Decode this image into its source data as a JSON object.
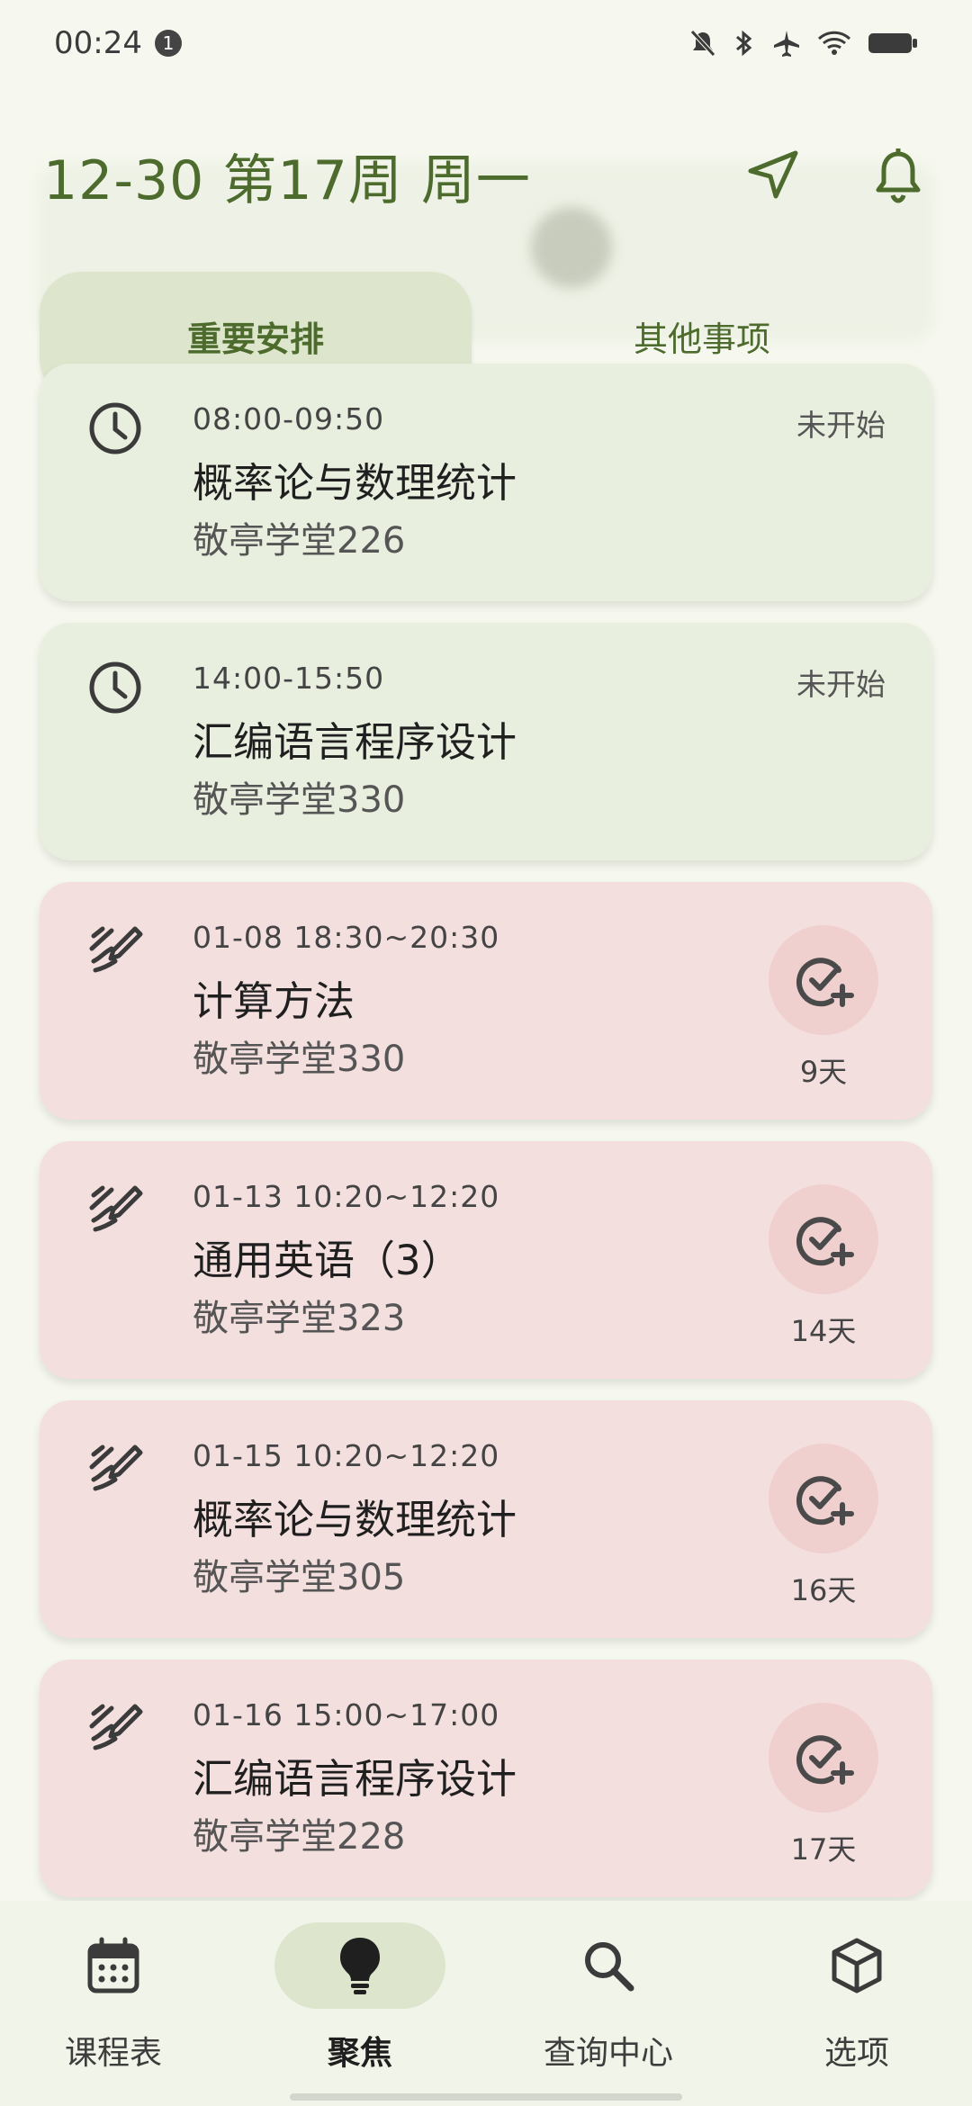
{
  "status_bar": {
    "time": "00:24",
    "notification_count": "1"
  },
  "header": {
    "title": "12-30 第17周 周一"
  },
  "tabs": [
    {
      "label": "重要安排",
      "active": true
    },
    {
      "label": "其他事项",
      "active": false
    }
  ],
  "cards": [
    {
      "type": "course",
      "icon": "clock-icon",
      "time": "08:00-09:50",
      "title": "概率论与数理统计",
      "place": "敬亭学堂226",
      "state": "未开始"
    },
    {
      "type": "course",
      "icon": "clock-icon",
      "time": "14:00-15:50",
      "title": "汇编语言程序设计",
      "place": "敬亭学堂330",
      "state": "未开始"
    },
    {
      "type": "exam",
      "icon": "pen-icon",
      "time": "01-08 18:30~20:30",
      "title": "计算方法",
      "place": "敬亭学堂330",
      "days": "9天"
    },
    {
      "type": "exam",
      "icon": "pen-icon",
      "time": "01-13 10:20~12:20",
      "title": "通用英语（3）",
      "place": "敬亭学堂323",
      "days": "14天"
    },
    {
      "type": "exam",
      "icon": "pen-icon",
      "time": "01-15 10:20~12:20",
      "title": "概率论与数理统计",
      "place": "敬亭学堂305",
      "days": "16天"
    },
    {
      "type": "exam",
      "icon": "pen-icon",
      "time": "01-16 15:00~17:00",
      "title": "汇编语言程序设计",
      "place": "敬亭学堂228",
      "days": "17天"
    }
  ],
  "bottom_nav": [
    {
      "label": "课程表",
      "icon": "calendar-icon",
      "active": false
    },
    {
      "label": "聚焦",
      "icon": "lightbulb-icon",
      "active": true
    },
    {
      "label": "查询中心",
      "icon": "search-icon",
      "active": false
    },
    {
      "label": "选项",
      "icon": "cube-icon",
      "active": false
    }
  ],
  "colors": {
    "accent": "#4c6b2d",
    "background": "#f6f8ef",
    "course_card": "#e9efdf",
    "exam_card": "#f4dfdf",
    "tab_active": "#dde6cc"
  }
}
